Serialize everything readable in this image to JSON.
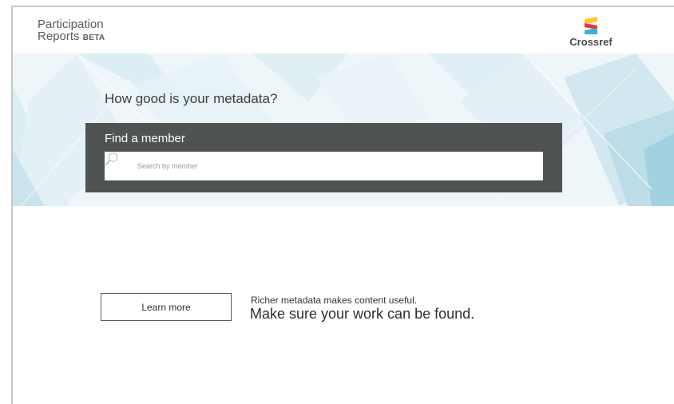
{
  "header": {
    "brand_line1": "Participation",
    "brand_line2": "Reports",
    "brand_badge": "BETA",
    "logo_text": "Crossref",
    "logo_colors": [
      "#ffc72c",
      "#ef3340",
      "#3eb1c8"
    ]
  },
  "hero": {
    "title": "How good is your metadata?",
    "search": {
      "label": "Find a member",
      "placeholder": "Search by member",
      "icon": "search-icon"
    },
    "background_color": "#eef6f9"
  },
  "content": {
    "learn_more_label": "Learn more",
    "tagline_small": "Richer metadata makes content useful.",
    "tagline_large": "Make sure your work can be found."
  },
  "colors": {
    "panel": "#4f5453",
    "text_dark": "#333333"
  }
}
